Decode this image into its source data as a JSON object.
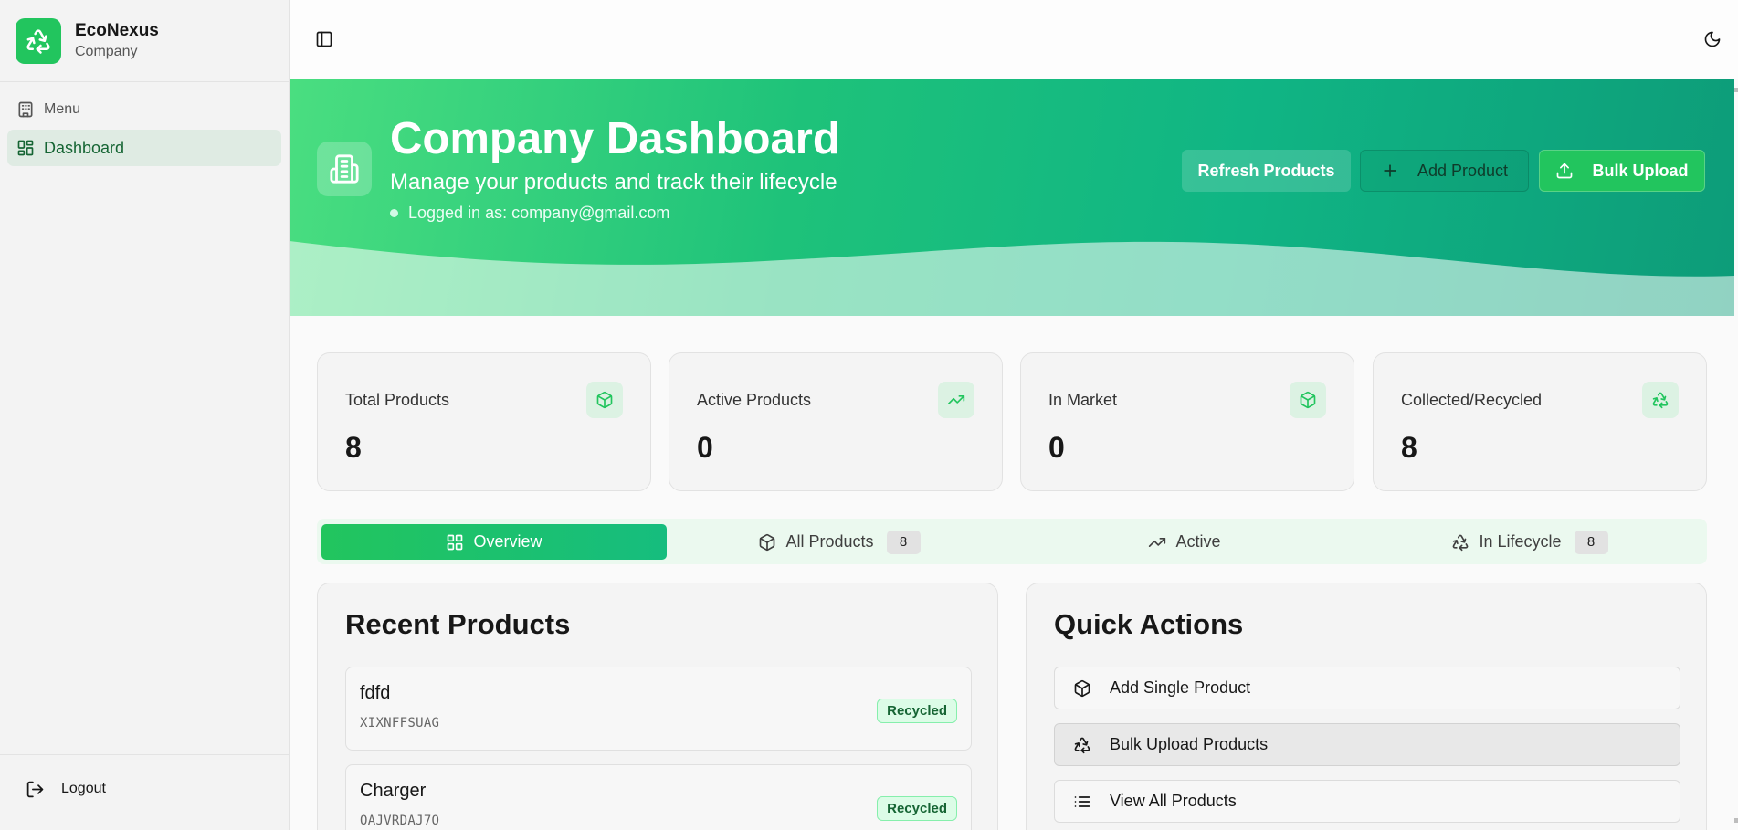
{
  "app": {
    "name": "EcoNexus",
    "role": "Company"
  },
  "sidebar": {
    "menu_label": "Menu",
    "items": [
      {
        "label": "Dashboard",
        "icon": "layout-grid-icon",
        "active": true
      }
    ],
    "logout_label": "Logout"
  },
  "topbar": {
    "toggle_icon": "sidebar-toggle-icon",
    "theme_icon": "moon-icon"
  },
  "hero": {
    "title": "Company Dashboard",
    "subtitle": "Manage your products and track their lifecycle",
    "user_text": "Logged in as: company@gmail.com",
    "buttons": {
      "refresh": "Refresh Products",
      "add": "Add Product",
      "bulk": "Bulk Upload"
    }
  },
  "stats": [
    {
      "label": "Total Products",
      "value": "8",
      "icon": "package-icon"
    },
    {
      "label": "Active Products",
      "value": "0",
      "icon": "trending-up-icon"
    },
    {
      "label": "In Market",
      "value": "0",
      "icon": "package-icon"
    },
    {
      "label": "Collected/Recycled",
      "value": "8",
      "icon": "recycle-icon"
    }
  ],
  "tabs": [
    {
      "label": "Overview",
      "active": true
    },
    {
      "label": "All Products",
      "badge": "8"
    },
    {
      "label": "Active"
    },
    {
      "label": "In Lifecycle",
      "badge": "8"
    }
  ],
  "recent_products": {
    "title": "Recent Products",
    "items": [
      {
        "name": "fdfd",
        "code": "XIXNFFSUAG",
        "status": "Recycled"
      },
      {
        "name": "Charger",
        "code": "OAJVRDAJ7O",
        "status": "Recycled"
      }
    ]
  },
  "quick_actions": {
    "title": "Quick Actions",
    "items": [
      {
        "label": "Add Single Product",
        "icon": "package-icon"
      },
      {
        "label": "Bulk Upload Products",
        "icon": "recycle-icon"
      },
      {
        "label": "View All Products",
        "icon": "list-icon"
      }
    ]
  },
  "colors": {
    "brand": "#22c55e",
    "sidebar_active_bg": "#dfebe3",
    "badge_green": "#dcfce7"
  }
}
